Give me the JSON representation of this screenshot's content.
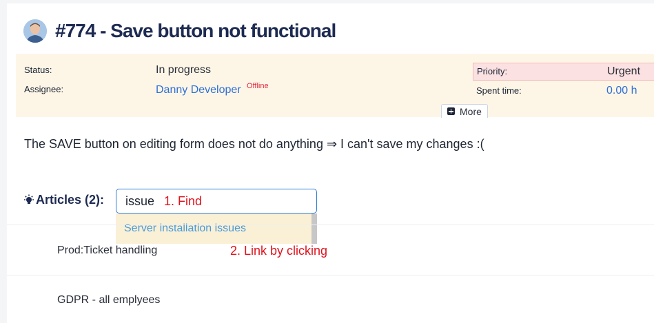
{
  "ticket": {
    "title": "#774 - Save button not functional",
    "status_label": "Status:",
    "status_value": "In progress",
    "assignee_label": "Assignee:",
    "assignee_value": "Danny Developer",
    "assignee_presence": "Offline",
    "priority_label": "Priority:",
    "priority_value": "Urgent",
    "spent_label": "Spent time:",
    "spent_value": "0.00 h",
    "more_label": "More",
    "description": "The SAVE button on editing form does not do anything ⇒ I can't save my changes :("
  },
  "articles": {
    "label": "Articles (2):",
    "search_value": "issue",
    "suggestions": [
      "Server installation issues"
    ],
    "items": [
      "Prod:Ticket handling",
      "GDPR - all emplyees"
    ]
  },
  "annotations": {
    "step1": "1. Find",
    "step2": "2. Link by clicking"
  },
  "icons": {
    "avatar": "user-avatar",
    "more": "plus-square-icon",
    "articles": "lightbulb-icon"
  },
  "colors": {
    "title": "#1d2a52",
    "link": "#2e6fd6",
    "offline": "#e0243c",
    "annotation": "#e0141e",
    "meta_bg": "#fdf6e7",
    "priority_bg": "#fbe1e1"
  }
}
